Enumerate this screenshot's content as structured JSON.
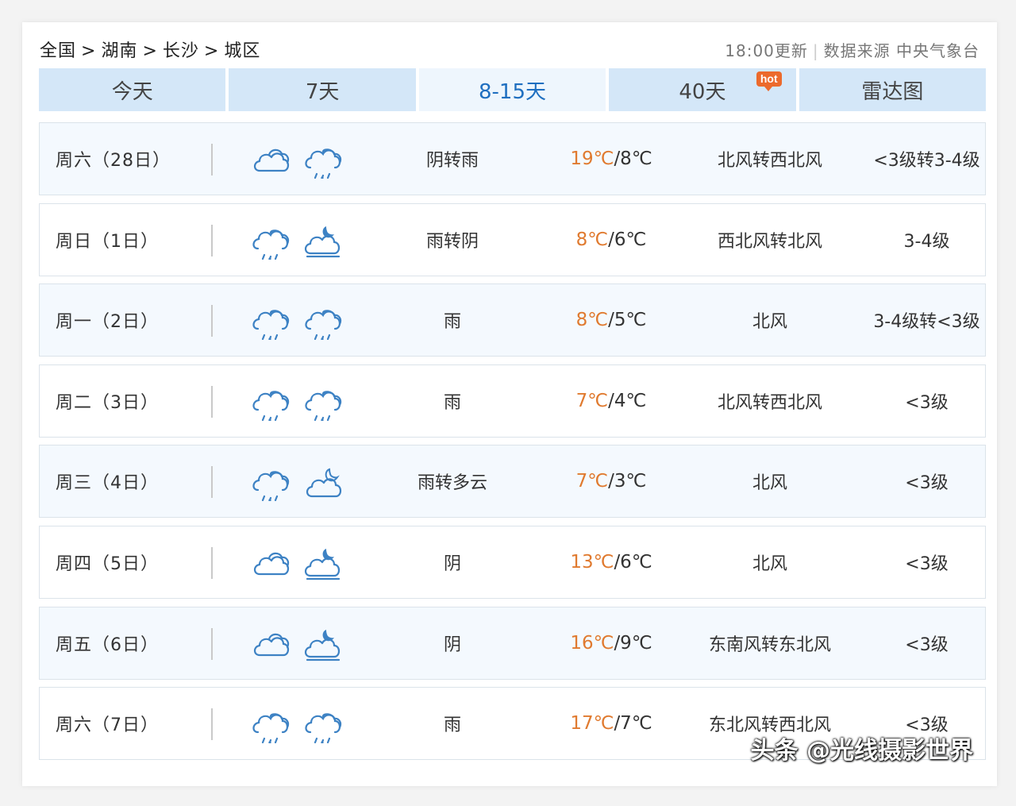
{
  "breadcrumb": {
    "items": [
      "全国",
      "湖南",
      "长沙",
      "城区"
    ],
    "separator": ">"
  },
  "meta": {
    "update": "18:00更新",
    "divider": "|",
    "source": "数据来源 中央气象台"
  },
  "tabs": [
    {
      "label": "今天",
      "active": false
    },
    {
      "label": "7天",
      "active": false
    },
    {
      "label": "8-15天",
      "active": true
    },
    {
      "label": "40天",
      "active": false,
      "badge": "hot"
    },
    {
      "label": "雷达图",
      "active": false
    }
  ],
  "forecast": [
    {
      "day": "周六（28日）",
      "icons": [
        "cloudy-icon",
        "rain-icon"
      ],
      "desc": "阴转雨",
      "high": "19℃",
      "low": "/8℃",
      "wind": "北风转西北风",
      "level": "<3级转3-4级"
    },
    {
      "day": "周日（1日）",
      "icons": [
        "rain-icon",
        "cloudy-night-icon"
      ],
      "desc": "雨转阴",
      "high": "8℃",
      "low": "/6℃",
      "wind": "西北风转北风",
      "level": "3-4级"
    },
    {
      "day": "周一（2日）",
      "icons": [
        "rain-icon",
        "rain-icon"
      ],
      "desc": "雨",
      "high": "8℃",
      "low": "/5℃",
      "wind": "北风",
      "level": "3-4级转<3级"
    },
    {
      "day": "周二（3日）",
      "icons": [
        "rain-icon",
        "rain-icon"
      ],
      "desc": "雨",
      "high": "7℃",
      "low": "/4℃",
      "wind": "北风转西北风",
      "level": "<3级"
    },
    {
      "day": "周三（4日）",
      "icons": [
        "rain-icon",
        "partly-cloudy-night-icon"
      ],
      "desc": "雨转多云",
      "high": "7℃",
      "low": "/3℃",
      "wind": "北风",
      "level": "<3级"
    },
    {
      "day": "周四（5日）",
      "icons": [
        "cloudy-icon",
        "cloudy-night-icon"
      ],
      "desc": "阴",
      "high": "13℃",
      "low": "/6℃",
      "wind": "北风",
      "level": "<3级"
    },
    {
      "day": "周五（6日）",
      "icons": [
        "cloudy-icon",
        "cloudy-night-icon"
      ],
      "desc": "阴",
      "high": "16℃",
      "low": "/9℃",
      "wind": "东南风转东北风",
      "level": "<3级"
    },
    {
      "day": "周六（7日）",
      "icons": [
        "rain-icon",
        "rain-icon"
      ],
      "desc": "雨",
      "high": "17℃",
      "low": "/7℃",
      "wind": "东北风转西北风",
      "level": "<3级"
    }
  ],
  "watermark": "头条 @光线摄影世界",
  "colors": {
    "tab_bg": "#d4e7f8",
    "tab_active_text": "#1f6fc0",
    "high_temp": "#e07a2f",
    "icon_stroke": "#3d82c4",
    "hot_badge": "#ec6a2c"
  }
}
